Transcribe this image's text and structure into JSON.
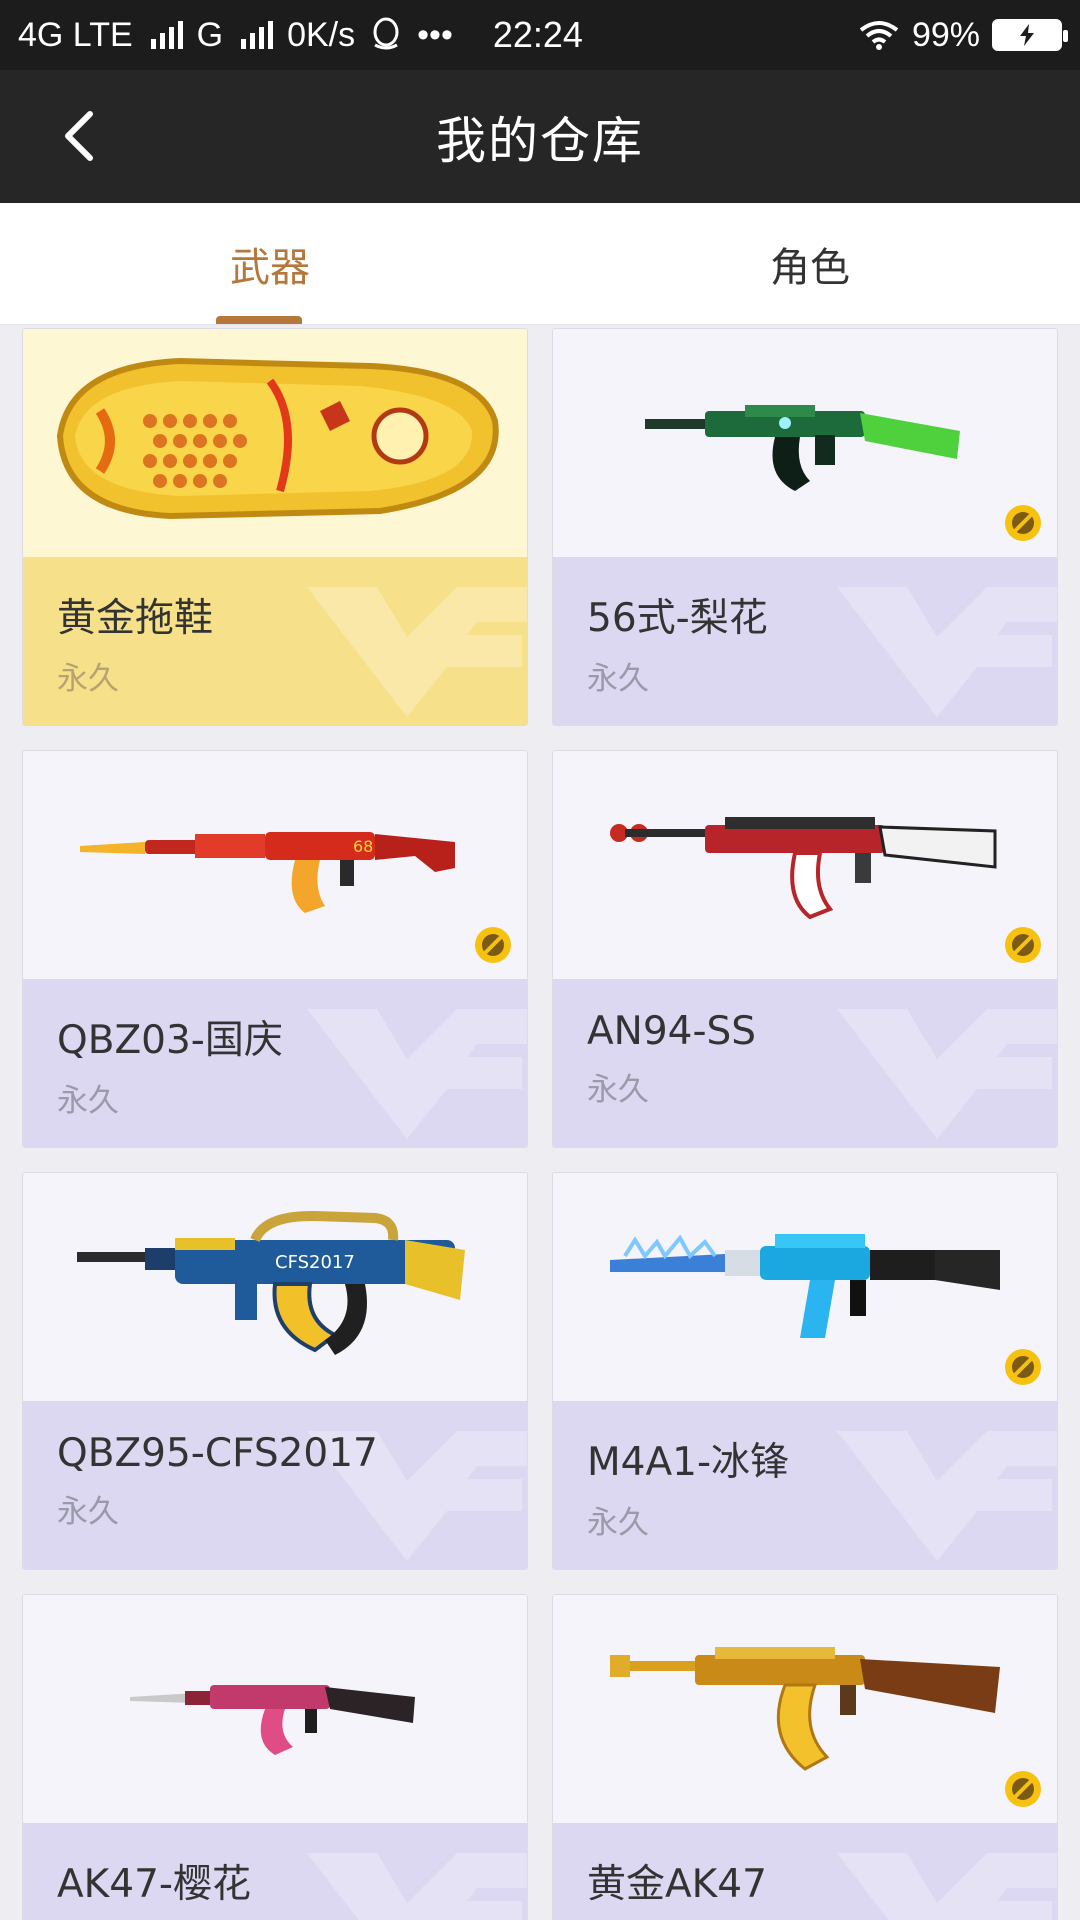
{
  "status": {
    "net1": "4G LTE",
    "net2": "G",
    "speed": "0K/s",
    "dots": "•••",
    "time": "22:24",
    "battery": "99%"
  },
  "header": {
    "title": "我的仓库"
  },
  "tabs": [
    {
      "label": "武器",
      "active": true
    },
    {
      "label": "角色",
      "active": false
    }
  ],
  "items": [
    {
      "name": "黄金拖鞋",
      "duration": "永久",
      "icon": "golden-slipper",
      "theme": "gold",
      "medal": false
    },
    {
      "name": "56式-梨花",
      "duration": "永久",
      "icon": "rifle-green",
      "theme": "purple",
      "medal": true
    },
    {
      "name": "QBZ03-国庆",
      "duration": "永久",
      "icon": "rifle-red-bayonet",
      "theme": "purple",
      "medal": true
    },
    {
      "name": "AN94-SS",
      "duration": "永久",
      "icon": "rifle-red-white",
      "theme": "purple",
      "medal": true
    },
    {
      "name": "QBZ95-CFS2017",
      "duration": "永久",
      "icon": "rifle-blue-yellow",
      "theme": "purple",
      "medal": false
    },
    {
      "name": "M4A1-冰锋",
      "duration": "永久",
      "icon": "rifle-ice",
      "theme": "purple",
      "medal": true
    },
    {
      "name": "AK47-樱花",
      "duration": "",
      "icon": "rifle-pink",
      "theme": "purple",
      "medal": false
    },
    {
      "name": "黄金AK47",
      "duration": "",
      "icon": "rifle-gold",
      "theme": "purple",
      "medal": true
    }
  ],
  "colors": {
    "accent": "#b5773a",
    "card_info_bg": "#dcd8f2",
    "gold_info_bg": "#f7e08a"
  }
}
